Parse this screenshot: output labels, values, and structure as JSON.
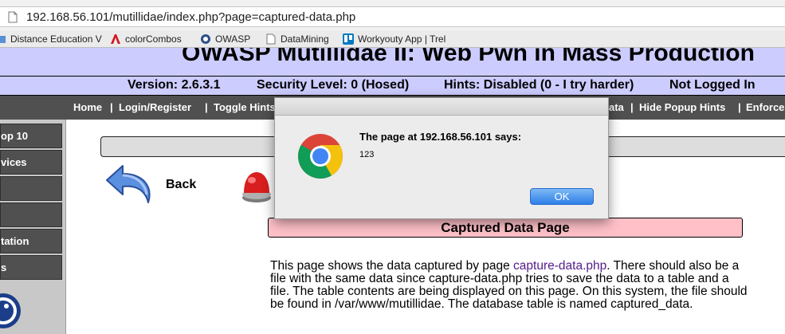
{
  "browser": {
    "url": "192.168.56.101/mutillidae/index.php?page=captured-data.php",
    "bookmarks": [
      {
        "label": "Distance Education V",
        "icon": "folder-icon"
      },
      {
        "label": "colorCombos",
        "icon": "adobe-icon"
      },
      {
        "label": "OWASP",
        "icon": "owasp-icon"
      },
      {
        "label": "DataMining",
        "icon": "page-icon"
      },
      {
        "label": "Workyouty App | Trel",
        "icon": "trello-icon"
      }
    ]
  },
  "site": {
    "title": "OWASP Mutillidae II: Web Pwn in Mass Production",
    "status": {
      "version": "Version: 2.6.3.1",
      "security": "Security Level: 0 (Hosed)",
      "hints": "Hints: Disabled (0 - I try harder)",
      "login": "Not Logged In"
    },
    "nav": [
      "Home",
      "Login/Register",
      "Toggle Hints",
      "ata",
      "Hide Popup Hints",
      "Enforce"
    ],
    "sidebar": [
      "op 10",
      "vices",
      "",
      "",
      "tation",
      "s"
    ]
  },
  "content": {
    "back_label": "Back",
    "page_heading": "Captured Data Page",
    "desc_part1": "This page shows the data captured by page ",
    "desc_link": "capture-data.php",
    "desc_part2": ". There should also be a file with the same data since capture-data.php tries to save the data to a table and a file. The table contents are being displayed on this page. On this system, the file should be found in /var/www/mutillidae. The database table is named captured_data."
  },
  "dialog": {
    "heading": "The page at 192.168.56.101 says:",
    "message": "123",
    "ok_label": "OK"
  },
  "colors": {
    "header_bg": "#ccccff",
    "nav_bg": "#505050",
    "heading_bg": "#ffc0c8",
    "ok_button": "#2f7fe8"
  }
}
